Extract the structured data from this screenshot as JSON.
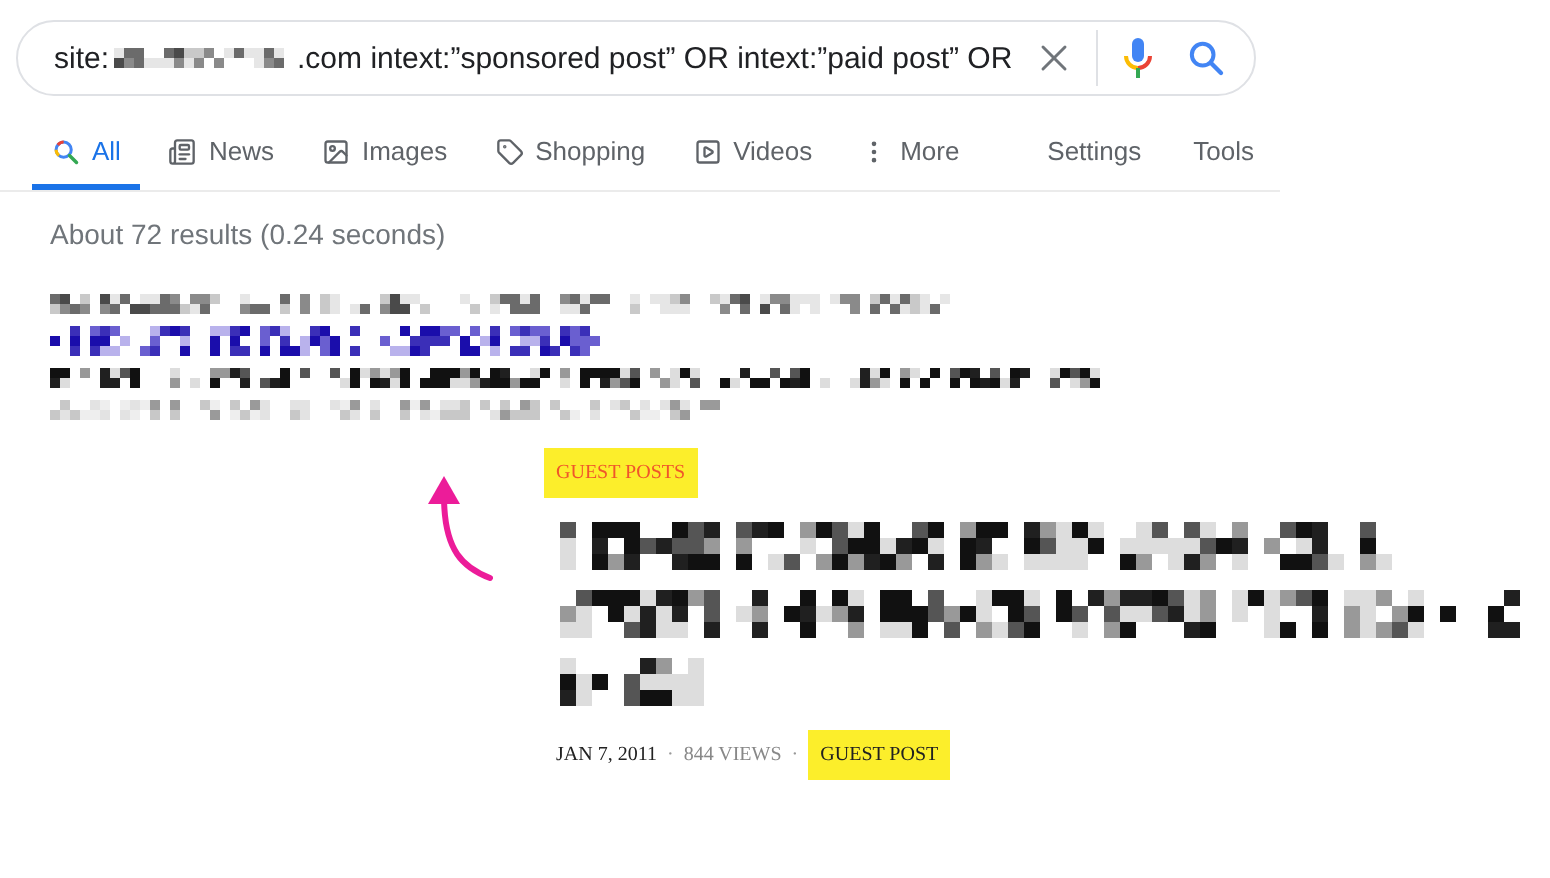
{
  "search": {
    "query_parts": [
      {
        "kind": "text",
        "text": "site:"
      },
      {
        "kind": "redacted"
      },
      {
        "kind": "text",
        "text": ".com intext:”sponsored post” OR intext:”paid post” OR"
      }
    ]
  },
  "tabs": [
    {
      "label": "All",
      "selected": true
    },
    {
      "label": "News",
      "selected": false
    },
    {
      "label": "Images",
      "selected": false
    },
    {
      "label": "Shopping",
      "selected": false
    },
    {
      "label": "Videos",
      "selected": false
    },
    {
      "label": "More",
      "selected": false
    }
  ],
  "tools": [
    "Settings",
    "Tools"
  ],
  "results_stats": "About 72 results (0.24 seconds)",
  "article": {
    "category": "GUEST POSTS",
    "meta": [
      {
        "kind": "date",
        "text": "JAN 7, 2011"
      },
      {
        "kind": "separator",
        "text": "·"
      },
      {
        "kind": "views",
        "text": "844 VIEWS"
      },
      {
        "kind": "separator",
        "text": "·"
      },
      {
        "kind": "tag",
        "text": "GUEST POST"
      }
    ]
  }
}
